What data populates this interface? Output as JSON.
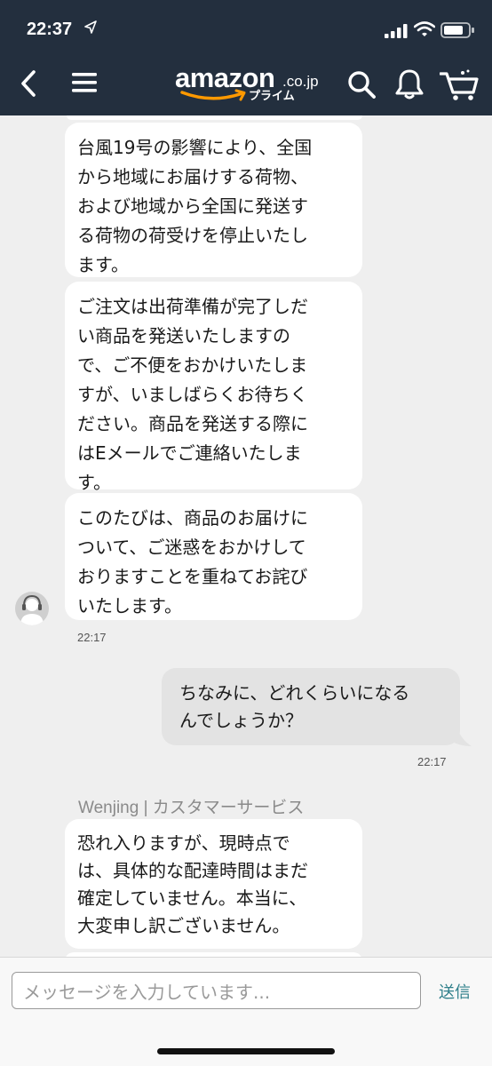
{
  "status_bar": {
    "time": "22:37"
  },
  "nav": {
    "logo_word": "amazon",
    "logo_suffix": ".co.jp",
    "logo_sub": "プライム",
    "brand_color": "#ff9900",
    "header_color": "#232f3e"
  },
  "chat": {
    "messages": [
      {
        "sender": "agent",
        "lines": [
          "台風19号の影響により、全国",
          "から地域にお届けする荷物、",
          "および地域から全国に発送す",
          "る荷物の荷受けを停止いたし",
          "ます。"
        ]
      },
      {
        "sender": "agent",
        "lines": [
          "ご注文は出荷準備が完了しだ",
          "い商品を発送いたしますの",
          "で、ご不便をおかけいたしま",
          "すが、いましばらくお待ちく",
          "ださい。商品を発送する際に",
          "はEメールでご連絡いたしま",
          "す。"
        ]
      },
      {
        "sender": "agent",
        "lines": [
          "このたびは、商品のお届けに",
          "ついて、ご迷惑をおかけして",
          "おりますことを重ねてお詫び",
          "いたします。"
        ],
        "time": "22:17"
      },
      {
        "sender": "user",
        "lines": [
          "ちなみに、どれくらいになる",
          "んでしょうか？"
        ],
        "time": "22:17"
      },
      {
        "sender": "agent",
        "agent_label": "Wenjing | カスタマーサービス",
        "lines": [
          "恐れ入りますが、現時点で",
          "は、具体的な配達時間はまだ",
          "確定していません。本当に、",
          "大変申し訳ございません。"
        ]
      }
    ]
  },
  "input": {
    "placeholder": "メッセージを入力しています...",
    "send_label": "送信"
  }
}
